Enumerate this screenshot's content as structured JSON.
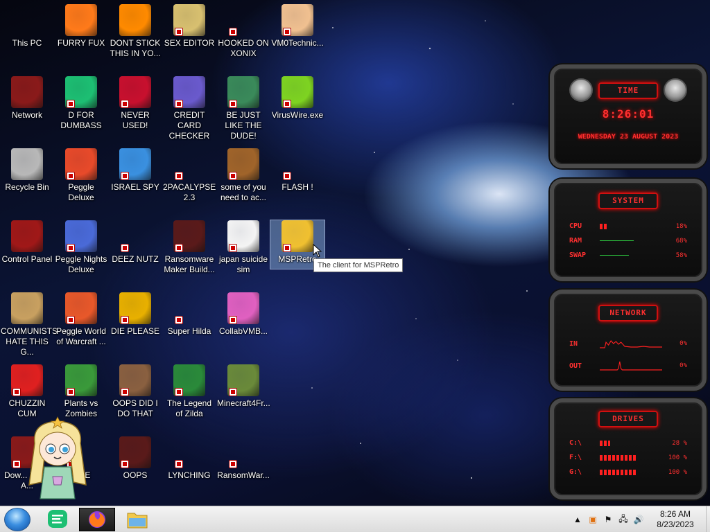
{
  "desktop": {
    "icons": [
      {
        "label": "This PC",
        "icon": "computer-icon"
      },
      {
        "label": "FURRY FUX",
        "icon": "firefox-icon"
      },
      {
        "label": "DONT STICK THIS IN YO...",
        "icon": "vlc-cone-icon"
      },
      {
        "label": "SEX EDITOR",
        "icon": "hxd-editor-icon"
      },
      {
        "label": "HOOKED ON XONIX",
        "icon": "xonix-game-icon"
      },
      {
        "label": "VM0Technic...",
        "icon": "technician-icon"
      },
      {
        "label": "Network",
        "icon": "network-alien-icon"
      },
      {
        "label": "D FOR DUMBASS",
        "icon": "green-chat-icon"
      },
      {
        "label": "NEVER USED!",
        "icon": "devcpp-icon"
      },
      {
        "label": "CREDIT CARD CHECKER",
        "icon": "credit-card-icon"
      },
      {
        "label": "BE JUST LIKE THE DUDE!",
        "icon": "dude-santa-icon"
      },
      {
        "label": "VirusWire.exe",
        "icon": "lime-icon"
      },
      {
        "label": "Recycle Bin",
        "icon": "recycle-bin-icon"
      },
      {
        "label": "Peggle Deluxe",
        "icon": "peggle-icon"
      },
      {
        "label": "ISRAEL SPY",
        "icon": "network-spy-icon"
      },
      {
        "label": "2PACALYPSE 2.3",
        "icon": "terminal-icon"
      },
      {
        "label": "some of you need to ac...",
        "icon": "bear-icon"
      },
      {
        "label": "FLASH !",
        "icon": "flash-icon"
      },
      {
        "label": "Control Panel",
        "icon": "control-panel-icon"
      },
      {
        "label": "Peggle Nights Deluxe",
        "icon": "peggle-nights-icon"
      },
      {
        "label": "DEEZ NUTZ",
        "icon": "window-stack-icon"
      },
      {
        "label": "Ransomware Maker Build...",
        "icon": "alien-book-icon"
      },
      {
        "label": "japan suicide sim",
        "icon": "document-icon"
      },
      {
        "label": "MSPRetro",
        "icon": "mspretro-icon"
      },
      {
        "label": "COMMUNISTS HATE THIS G...",
        "icon": "money-bag-icon"
      },
      {
        "label": "Peggle World of Warcraft ...",
        "icon": "peggle-wow-icon"
      },
      {
        "label": "DIE PLEASE",
        "icon": "after-effects-icon"
      },
      {
        "label": "Super Hilda",
        "icon": "pixel-character-icon"
      },
      {
        "label": "CollabVMB...",
        "icon": "monitor-pink-icon"
      },
      {
        "label": "CHUZZIN CUM",
        "icon": "chuzzle-icon"
      },
      {
        "label": "Plants vs Zombies",
        "icon": "plant-icon"
      },
      {
        "label": "OOPS DID I DO THAT",
        "icon": "portrait-icon"
      },
      {
        "label": "The Legend of Zilda",
        "icon": "zelda-pixel-icon"
      },
      {
        "label": "Minecraft4Fr...",
        "icon": "grass-block-icon"
      },
      {
        "label": "Dow... Black A...",
        "icon": "alien-head-icon"
      },
      {
        "label": "...NE",
        "icon": "unknown-icon"
      },
      {
        "label": "OOPS",
        "icon": "alien-book-icon"
      },
      {
        "label": "LYNCHING",
        "icon": "rope-icon"
      },
      {
        "label": "RansomWar...",
        "icon": "skull-ring-icon"
      }
    ],
    "tooltip": "The client for MSPRetro"
  },
  "gadget": {
    "time": {
      "header": "TIME",
      "clock": "8:26:01",
      "date": "WEDNESDAY 23 AUGUST 2023"
    },
    "system": {
      "header": "SYSTEM",
      "rows": [
        {
          "label": "CPU",
          "value": "18%",
          "percent": 18
        },
        {
          "label": "RAM",
          "value": "68%",
          "percent": 68
        },
        {
          "label": "SWAP",
          "value": "58%",
          "percent": 58
        }
      ]
    },
    "network": {
      "header": "NETWORK",
      "rows": [
        {
          "label": "IN",
          "value": "0%"
        },
        {
          "label": "OUT",
          "value": "0%"
        }
      ]
    },
    "drives": {
      "header": "DRIVES",
      "rows": [
        {
          "label": "C:\\",
          "value": "28 %",
          "percent": 28
        },
        {
          "label": "F:\\",
          "value": "100 %",
          "percent": 100
        },
        {
          "label": "G:\\",
          "value": "100 %",
          "percent": 100
        }
      ]
    }
  },
  "taskbar": {
    "items": [
      "start-orb",
      "green-chat-app",
      "firefox",
      "file-explorer"
    ],
    "clock_time": "8:26 AM",
    "clock_date": "8/23/2023",
    "tray_icons": [
      "chevron-up-icon",
      "notification-app-icon",
      "flag-icon",
      "network-icon",
      "volume-icon"
    ]
  },
  "colors": {
    "gadget_red": "#ff2020",
    "taskbar": "#e8e8e8"
  }
}
